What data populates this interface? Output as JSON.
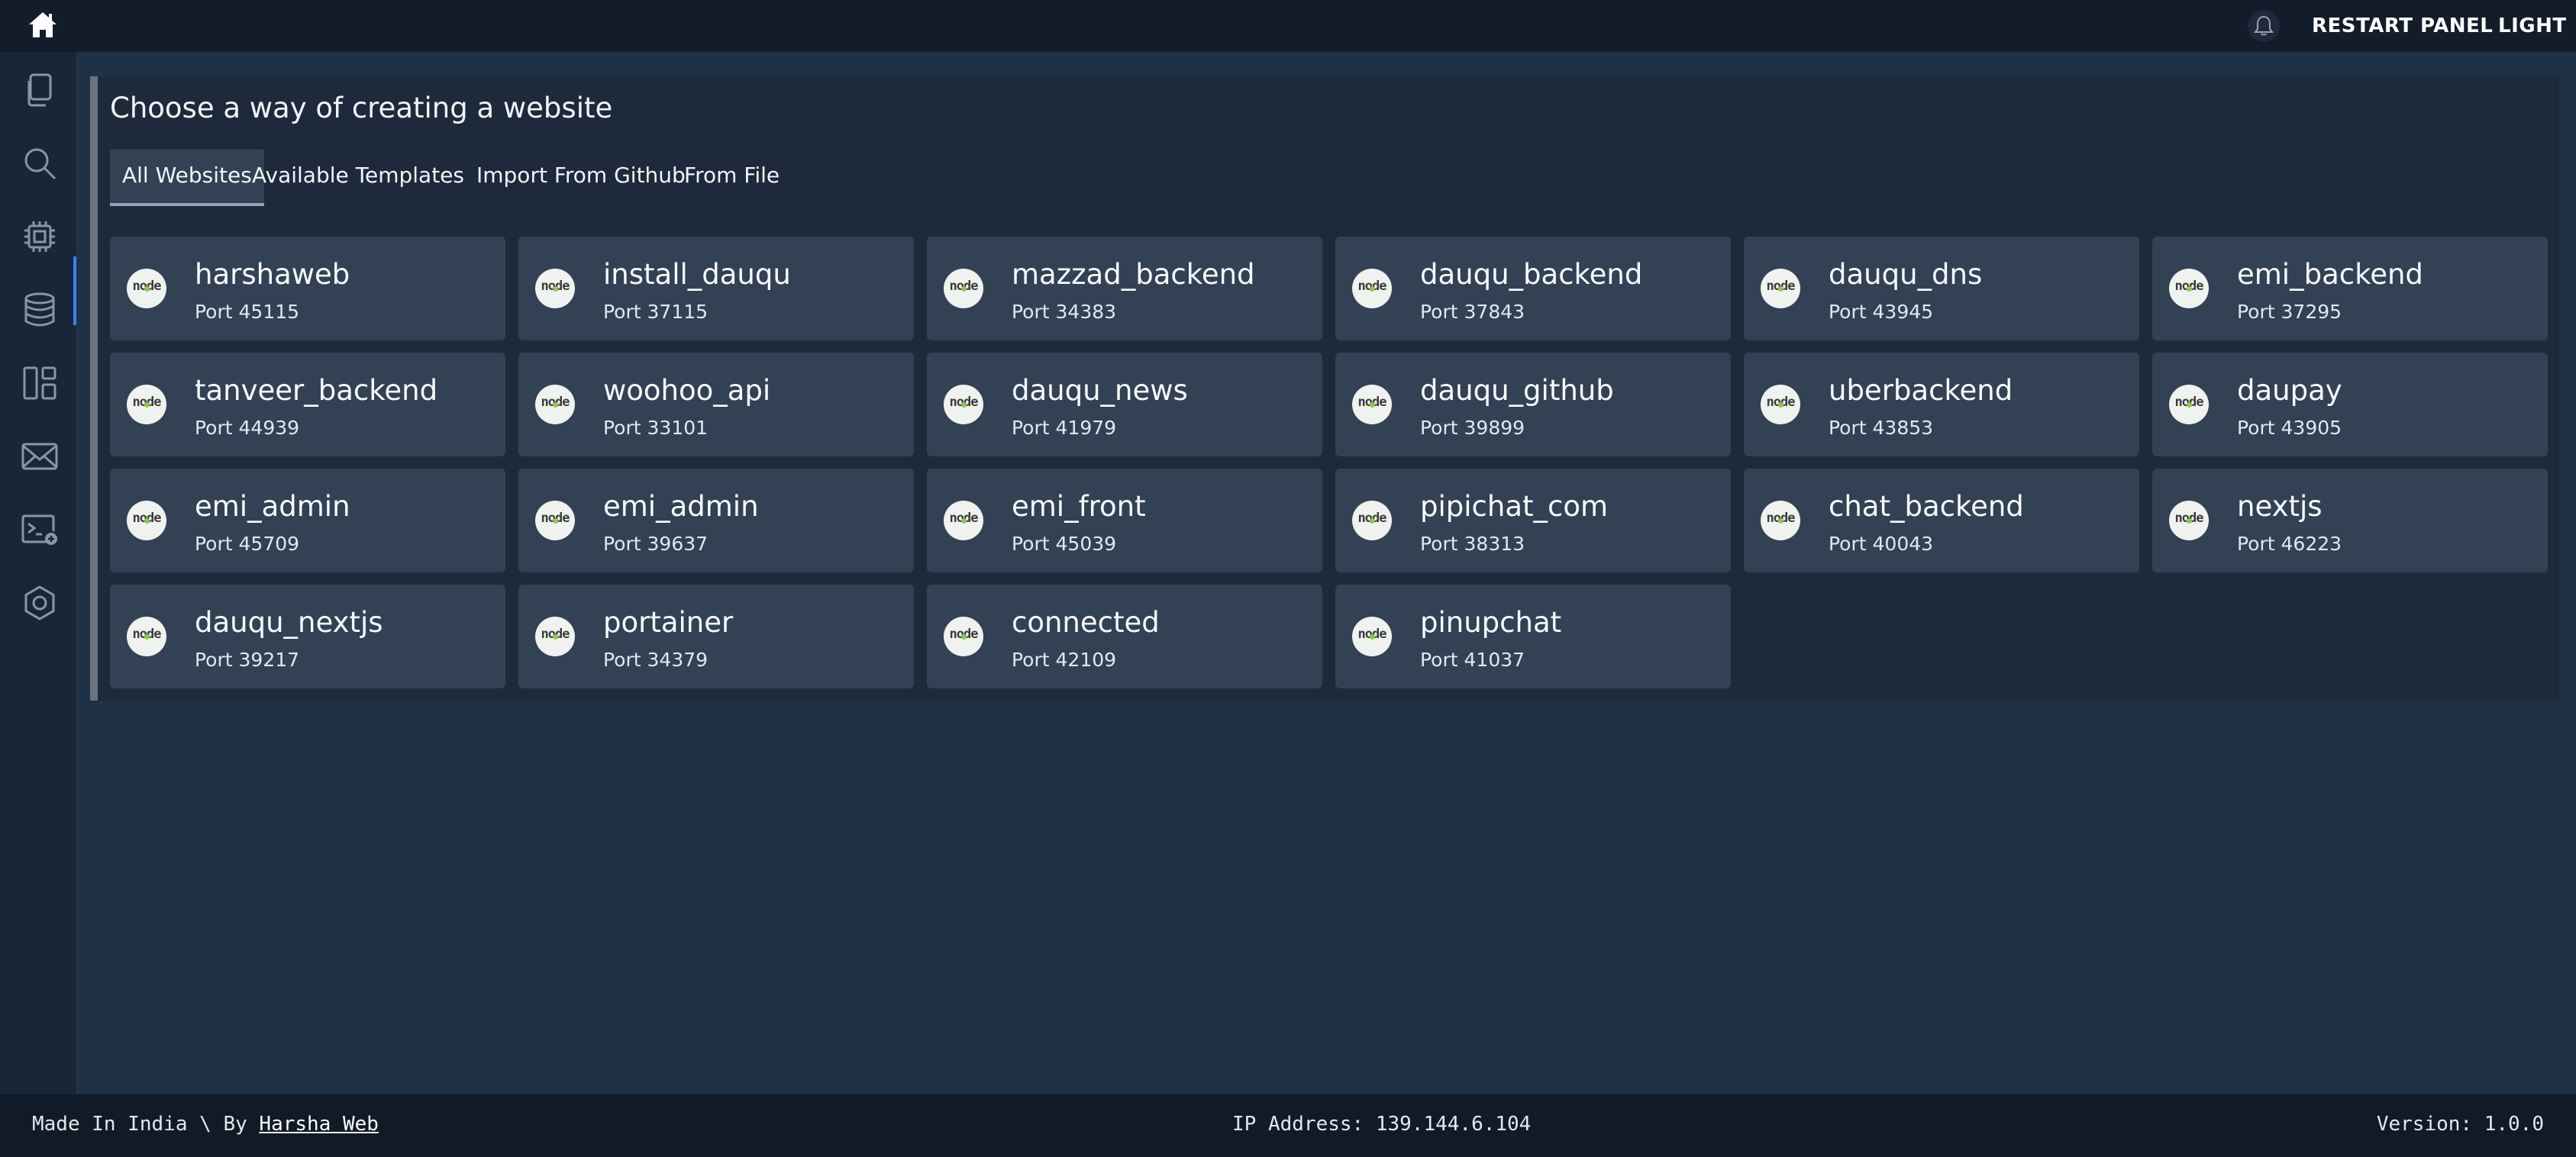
{
  "topbar": {
    "home_icon": "home-icon",
    "notification_icon": "bell-icon",
    "restart_label": "RESTART PANEL",
    "theme_label": "LIGHT"
  },
  "sidebar": {
    "items": [
      {
        "icon": "files-icon"
      },
      {
        "icon": "search-icon"
      },
      {
        "icon": "cpu-icon",
        "active": true
      },
      {
        "icon": "database-icon"
      },
      {
        "icon": "layout-icon"
      },
      {
        "icon": "mail-icon"
      },
      {
        "icon": "terminal-add-icon"
      },
      {
        "icon": "hexagon-settings-icon"
      }
    ]
  },
  "main": {
    "title": "Choose a way of creating a website",
    "tabs": [
      {
        "label": "All Websites",
        "active": true
      },
      {
        "label": "Available Templates"
      },
      {
        "label": "Import From Github"
      },
      {
        "label": "From File"
      }
    ],
    "logo_text": "node",
    "websites": [
      {
        "name": "harshaweb",
        "port": "Port 45115"
      },
      {
        "name": "install_dauqu",
        "port": "Port 37115"
      },
      {
        "name": "mazzad_backend",
        "port": "Port 34383"
      },
      {
        "name": "dauqu_backend",
        "port": "Port 37843"
      },
      {
        "name": "dauqu_dns",
        "port": "Port 43945"
      },
      {
        "name": "emi_backend",
        "port": "Port 37295"
      },
      {
        "name": "tanveer_backend",
        "port": "Port 44939"
      },
      {
        "name": "woohoo_api",
        "port": "Port 33101"
      },
      {
        "name": "dauqu_news",
        "port": "Port 41979"
      },
      {
        "name": "dauqu_github",
        "port": "Port 39899"
      },
      {
        "name": "uberbackend",
        "port": "Port 43853"
      },
      {
        "name": "daupay",
        "port": "Port 43905"
      },
      {
        "name": "emi_admin",
        "port": "Port 45709"
      },
      {
        "name": "emi_admin",
        "port": "Port 39637"
      },
      {
        "name": "emi_front",
        "port": "Port 45039"
      },
      {
        "name": "pipichat_com",
        "port": "Port 38313"
      },
      {
        "name": "chat_backend",
        "port": "Port 40043"
      },
      {
        "name": "nextjs",
        "port": "Port 46223"
      },
      {
        "name": "dauqu_nextjs",
        "port": "Port 39217"
      },
      {
        "name": "portainer",
        "port": "Port 34379"
      },
      {
        "name": "connected",
        "port": "Port 42109"
      },
      {
        "name": "pinupchat",
        "port": "Port 41037"
      }
    ]
  },
  "footer": {
    "made_in": "Made In India \\ By ",
    "author_link": "Harsha Web",
    "ip_address": "IP Address: 139.144.6.104",
    "version": "Version: 1.0.0"
  }
}
